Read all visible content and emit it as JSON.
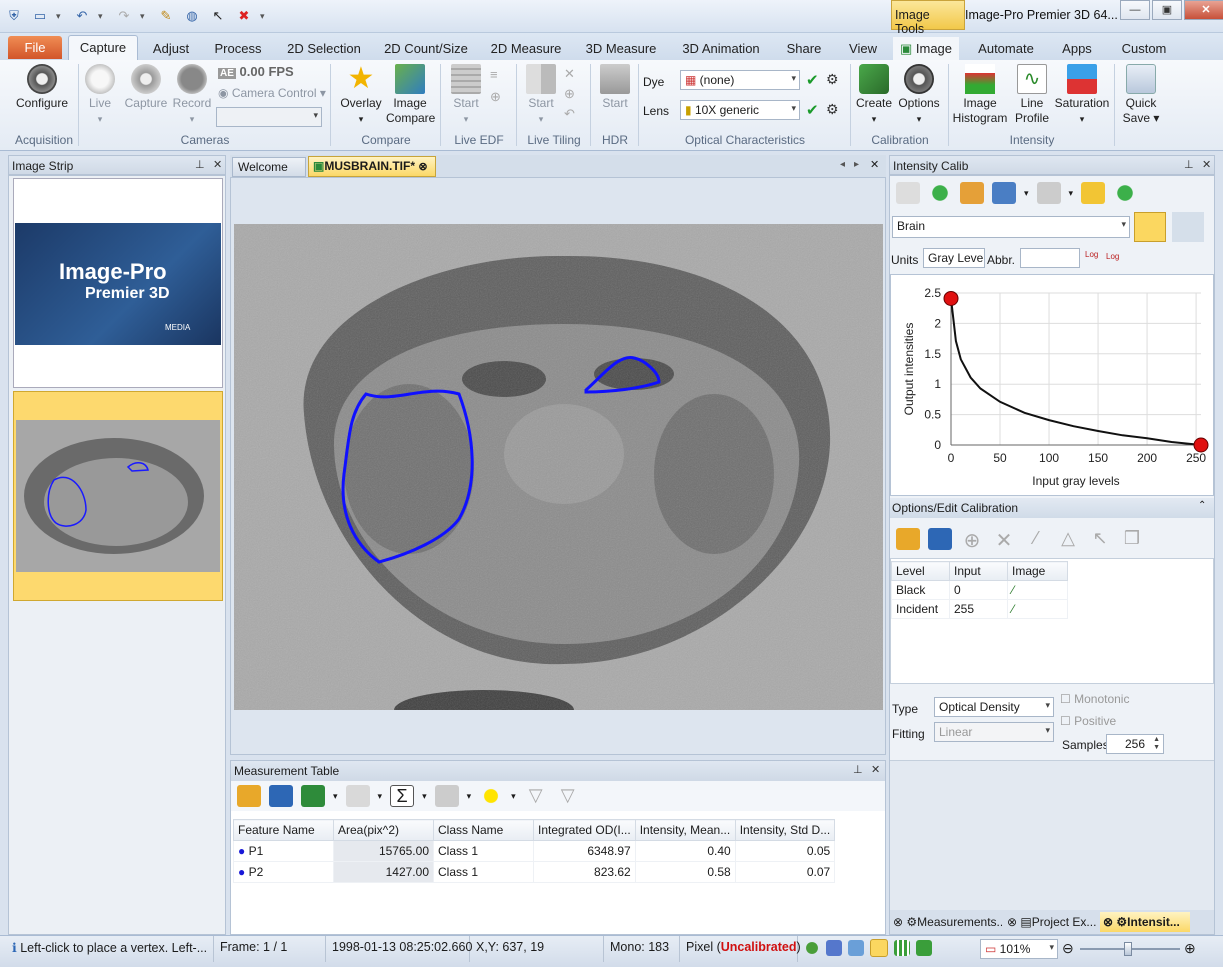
{
  "app": {
    "title": "Image-Pro Premier 3D 64...",
    "context_tab": "Image Tools"
  },
  "tabs": [
    "File",
    "Capture",
    "Adjust",
    "Process",
    "2D Selection",
    "2D Count/Size",
    "2D Measure",
    "3D Measure",
    "3D Animation",
    "Share",
    "View",
    "Image",
    "Automate",
    "Apps",
    "Custom"
  ],
  "ribbon": {
    "fps": "0.00 FPS",
    "buttons": {
      "configure": "Configure",
      "live": "Live",
      "capture": "Capture",
      "record": "Record",
      "camera_control": "Camera Control",
      "overlay": "Overlay",
      "image_compare_1": "Image",
      "image_compare_2": "Compare",
      "edf_start": "Start",
      "tiling_start": "Start",
      "hdr_start": "Start",
      "create": "Create",
      "options": "Options",
      "histogram_1": "Image",
      "histogram_2": "Histogram",
      "profile_1": "Line",
      "profile_2": "Profile",
      "saturation": "Saturation",
      "quicksave_1": "Quick",
      "quicksave_2": "Save"
    },
    "dye_label": "Dye",
    "dye_value": "(none)",
    "lens_label": "Lens",
    "lens_value": "10X generic",
    "groups": {
      "acquisition": "Acquisition",
      "cameras": "Cameras",
      "compare": "Compare",
      "live_edf": "Live EDF",
      "live_tiling": "Live Tiling",
      "hdr": "HDR",
      "optical": "Optical Characteristics",
      "calibration": "Calibration",
      "intensity": "Intensity"
    }
  },
  "image_strip": {
    "title": "Image Strip",
    "logo_line1": "Image-Pro",
    "logo_line2": "Premier 3D",
    "logo_brand": "MEDIA"
  },
  "doc_tabs": {
    "welcome": "Welcome",
    "active": "MUSBRAIN.TIF*"
  },
  "measurement": {
    "title": "Measurement Table",
    "columns": [
      "Feature Name",
      "Area(pix^2)",
      "Class Name",
      "Integrated OD(I...",
      "Intensity, Mean...",
      "Intensity, Std D..."
    ],
    "rows": [
      [
        "P1",
        "15765.00",
        "Class 1",
        "6348.97",
        "0.40",
        "0.05"
      ],
      [
        "P2",
        "1427.00",
        "Class 1",
        "823.62",
        "0.58",
        "0.07"
      ]
    ]
  },
  "intensity_calib": {
    "title": "Intensity Calib",
    "calibration_name": "Brain",
    "units_label": "Units",
    "units_value": "Gray Level",
    "abbr_label": "Abbr.",
    "abbr_value": "",
    "options_title": "Options/Edit Calibration",
    "table_cols": [
      "Level",
      "Input",
      "Image"
    ],
    "table_rows": [
      [
        "Black",
        "0"
      ],
      [
        "Incident",
        "255"
      ]
    ],
    "type_label": "Type",
    "type_value": "Optical Density",
    "fitting_label": "Fitting",
    "fitting_value": "Linear",
    "monotonic": "Monotonic",
    "positive": "Positive",
    "samples_label": "Samples",
    "samples_value": "256"
  },
  "chart_data": {
    "type": "line",
    "xlabel": "Input gray levels",
    "ylabel": "Output intensities",
    "xlim": [
      0,
      255
    ],
    "ylim": [
      0,
      2.5
    ],
    "xticks": [
      "0",
      "50",
      "100",
      "150",
      "200",
      "250"
    ],
    "yticks": [
      "0",
      "0.5",
      "1",
      "1.5",
      "2",
      "2.5"
    ],
    "series": [
      {
        "x": [
          0,
          5,
          10,
          20,
          30,
          50,
          75,
          100,
          125,
          150,
          175,
          200,
          225,
          255
        ],
        "values": [
          2.41,
          1.71,
          1.41,
          1.11,
          0.93,
          0.71,
          0.53,
          0.41,
          0.31,
          0.23,
          0.16,
          0.11,
          0.05,
          0.0
        ]
      }
    ],
    "control_points": [
      [
        0,
        2.41
      ],
      [
        255,
        0.0
      ]
    ],
    "grid": true,
    "colors": {
      "line": "#111111",
      "point": "#e01010"
    }
  },
  "bottom_tabs": [
    "Measurements...",
    "Project Ex...",
    "Intensit..."
  ],
  "status": {
    "hint": "Left-click to place a vertex. Left-...",
    "frame": "Frame: 1 / 1",
    "timestamp": "1998-01-13 08:25:02.660",
    "xy": "X,Y:  637,   19",
    "mono": "Mono:   183",
    "pixel": "Pixel (",
    "uncal": "Uncalibrated",
    ")": ")",
    "zoom": "101%"
  }
}
